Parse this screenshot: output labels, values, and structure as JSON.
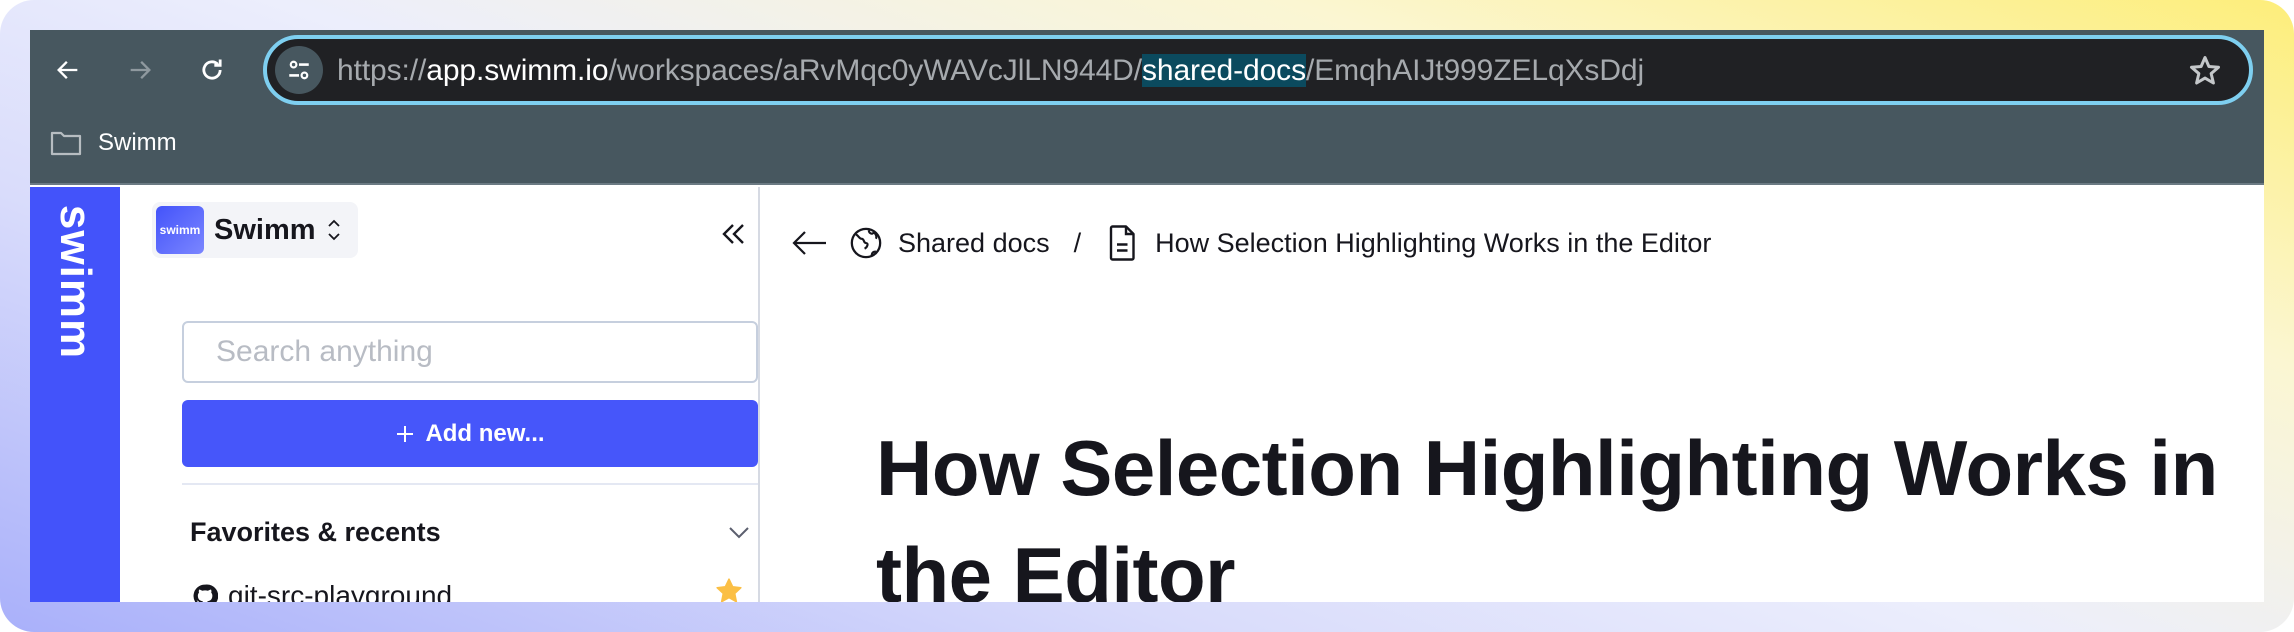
{
  "browser": {
    "url": {
      "scheme": "https://",
      "host": "app.swimm.io",
      "path_before": "/workspaces/aRvMqc0yWAVcJlLN944D/",
      "path_highlight": "shared-docs",
      "path_after": "/EmqhAIJt999ZELqXsDdj"
    },
    "bookmarks": [
      {
        "label": "Swimm",
        "icon": "folder-icon"
      }
    ],
    "colors": {
      "toolbar": "#47575f",
      "urlbar": "#202124",
      "focus_ring": "#7ecff0"
    }
  },
  "app": {
    "rail_logo": "swimm",
    "accent_color": "#4353fa",
    "sidebar": {
      "workspace": {
        "logo_text": "swimm",
        "name": "Swimm"
      },
      "search": {
        "placeholder": "Search anything",
        "value": ""
      },
      "add_button": {
        "icon": "plus-icon",
        "label": "Add new..."
      },
      "sections": [
        {
          "title": "Favorites & recents",
          "expanded": true,
          "items": [
            {
              "icon": "github-icon",
              "label": "git-src-playground",
              "favorite": true
            }
          ]
        }
      ]
    },
    "main": {
      "breadcrumb": [
        {
          "icon": "globe-icon",
          "label": "Shared docs"
        },
        {
          "icon": "document-icon",
          "label": "How Selection Highlighting Works in the Editor"
        }
      ],
      "breadcrumb_separator": "/",
      "doc_title": "How Selection Highlighting Works in the Editor"
    }
  }
}
